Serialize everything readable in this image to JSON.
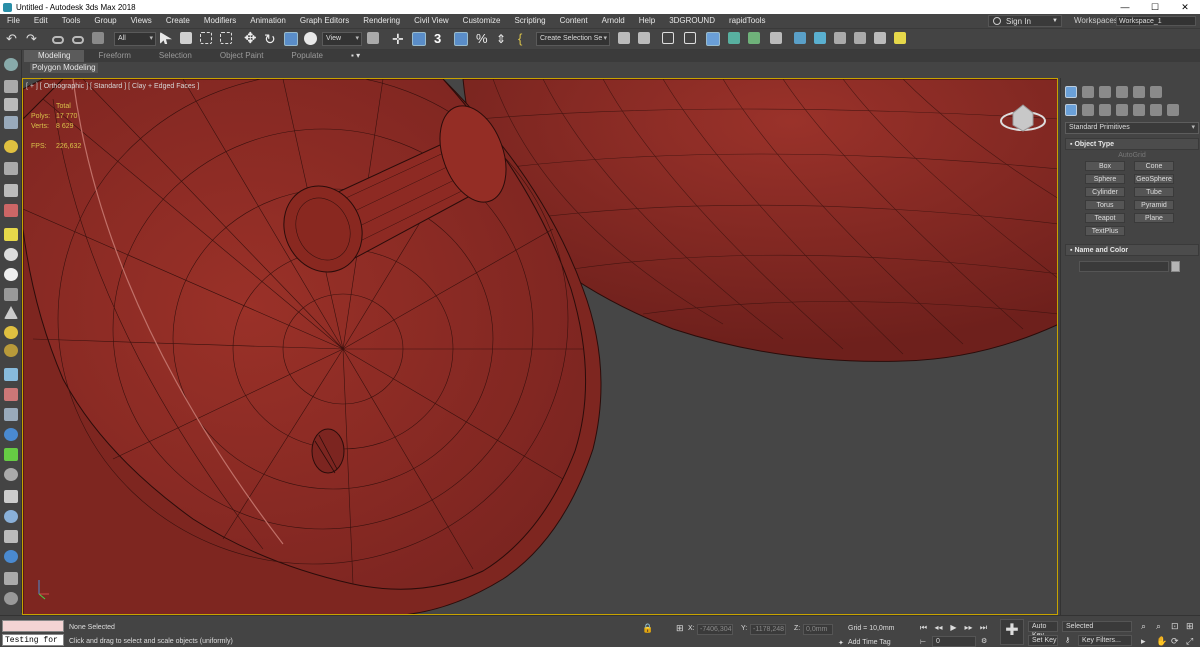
{
  "window": {
    "title": "Untitled - Autodesk 3ds Max 2018",
    "controls": [
      "—",
      "☐",
      "✕"
    ]
  },
  "menubar": {
    "items": [
      "File",
      "Edit",
      "Tools",
      "Group",
      "Views",
      "Create",
      "Modifiers",
      "Animation",
      "Graph Editors",
      "Rendering",
      "Civil View",
      "Customize",
      "Scripting",
      "Content",
      "Arnold",
      "Help",
      "3DGROUND",
      "rapidTools"
    ],
    "sign_in": "Sign In",
    "workspaces_label": "Workspaces:",
    "workspace_value": "Workspace_1"
  },
  "toolbar": {
    "filter_value": "All",
    "coord_system": "View",
    "selection_set": "Create Selection Se",
    "snap_label": "3",
    "icons": [
      "undo-icon",
      "redo-icon",
      "link-icon",
      "unlink-icon",
      "bind-spacewarp-icon",
      "select-object-icon",
      "select-by-name-icon",
      "rect-region-icon",
      "window-crossing-icon",
      "move-icon",
      "rotate-icon",
      "scale-icon",
      "select-manipulate-icon",
      "pivot-icon",
      "keyboard-shortcut-icon",
      "snap-toggle-icon",
      "angle-snap-icon",
      "percent-snap-icon",
      "spinner-snap-icon",
      "edit-named-sets-icon",
      "mirror-icon",
      "align-icon",
      "layer-explorer-icon",
      "toggle-ribbon-icon",
      "curve-editor-icon",
      "schematic-view-icon",
      "material-editor-icon",
      "render-setup-icon",
      "rendered-frame-icon",
      "render-icon",
      "render-cloud-icon",
      "a360-icon",
      "project-icon"
    ]
  },
  "ribbon": {
    "tabs": [
      "Modeling",
      "Freeform",
      "Selection",
      "Object Paint",
      "Populate"
    ],
    "active_tab": "Modeling",
    "panel_label": "Polygon Modeling"
  },
  "viewport": {
    "label": "[ + ] [ Orthographic ] [ Standard ] [ Clay + Edged Faces ]",
    "stats": {
      "total_label": "Total",
      "polys_label": "Polys:",
      "polys_value": "17 770",
      "verts_label": "Verts:",
      "verts_value": "8 629",
      "fps_label": "FPS:",
      "fps_value": "226,632"
    },
    "colors": {
      "clay": "#8f2b24",
      "background": "#464646",
      "active_border": "#c7a300"
    }
  },
  "command_panel": {
    "tab_icons": [
      "create-tab-icon",
      "modify-tab-icon",
      "hierarchy-tab-icon",
      "motion-tab-icon",
      "display-tab-icon",
      "utilities-tab-icon"
    ],
    "category_icons": [
      "geometry-icon",
      "shapes-icon",
      "lights-icon",
      "cameras-icon",
      "helpers-icon",
      "space-warps-icon",
      "systems-icon"
    ],
    "dropdown": "Standard Primitives",
    "object_type": {
      "header": "Object Type",
      "autogrid": "AutoGrid",
      "buttons": [
        "Box",
        "Cone",
        "Sphere",
        "GeoSphere",
        "Cylinder",
        "Tube",
        "Torus",
        "Pyramid",
        "Teapot",
        "Plane",
        "TextPlus"
      ]
    },
    "name_and_color": {
      "header": "Name and Color"
    }
  },
  "statusbar": {
    "maxscript_input": "Testing for :",
    "selection_status": "None Selected",
    "prompt": "Click and drag to select and scale objects (uniformly)",
    "x_label": "X:",
    "x_value": "-7406,304",
    "y_label": "Y:",
    "y_value": "-1178,248",
    "z_label": "Z:",
    "z_value": "0,0mm",
    "grid": "Grid = 10,0mm",
    "add_time_tag": "Add Time Tag",
    "frame_value": "0",
    "auto_key": "Auto Key",
    "set_key": "Set Key",
    "key_mode_value": "Selected",
    "key_filters": "Key Filters..."
  }
}
